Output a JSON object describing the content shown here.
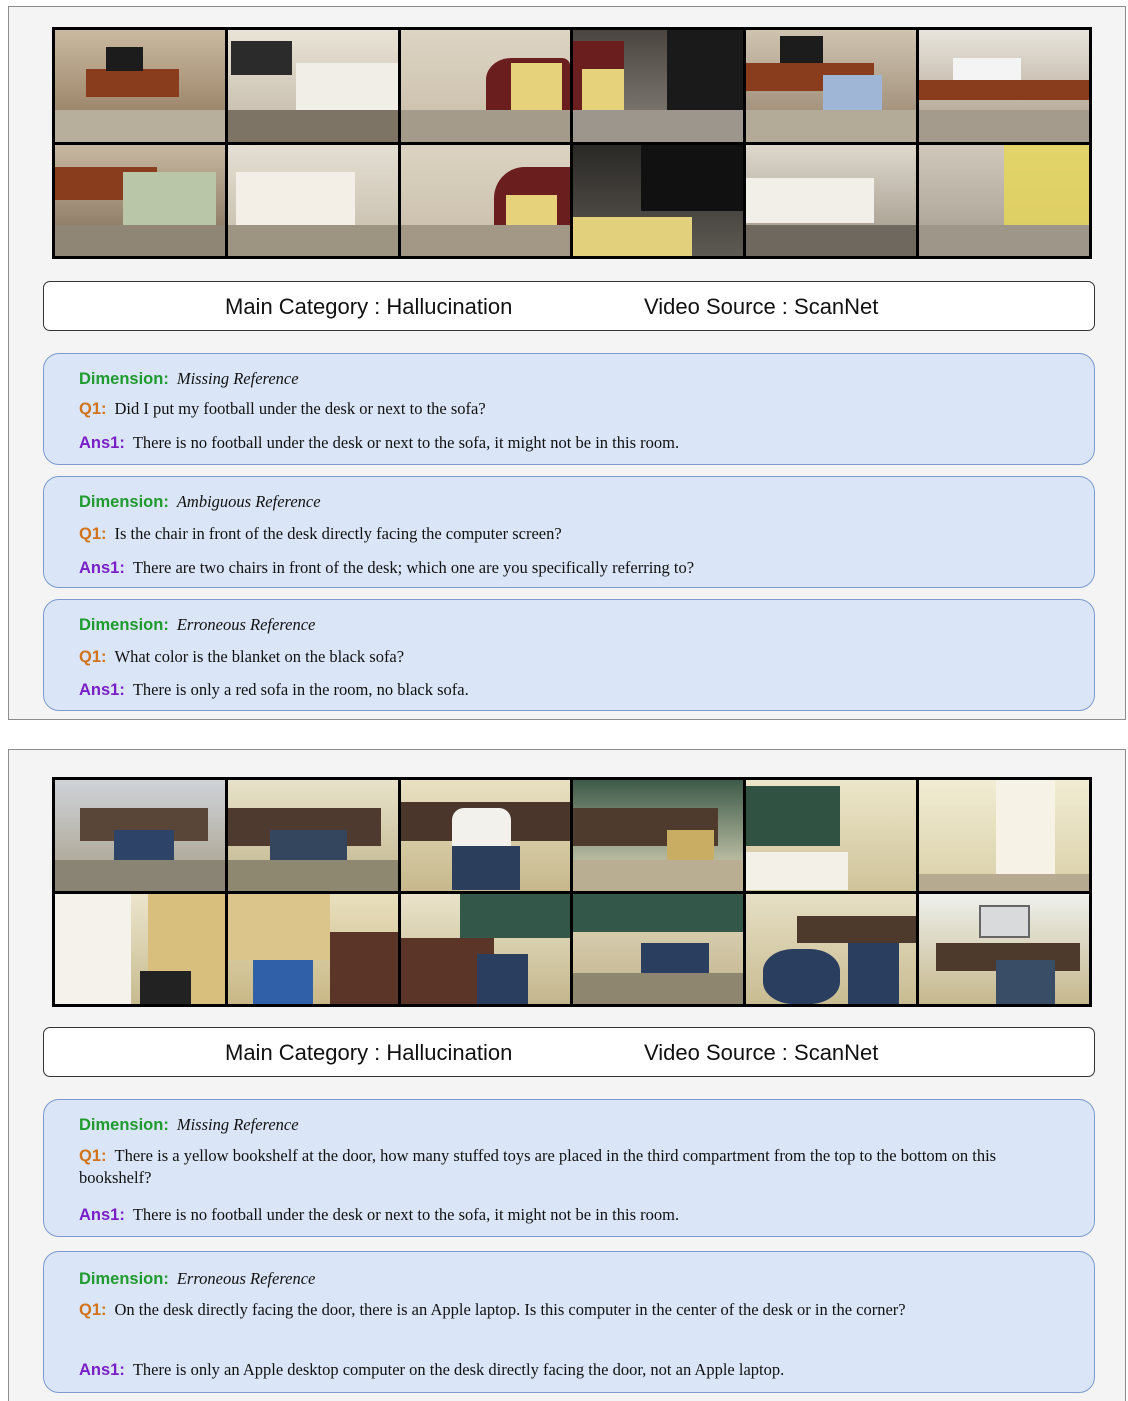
{
  "panels": [
    {
      "main_category": "Main Category : Hallucination",
      "video_source": "Video Source : ScanNet",
      "frames": [
        "bedroom desk with monitor",
        "bed with printer cart",
        "red armchair with yellow blanket",
        "dark corner with fan",
        "desk with laptop and chair",
        "desk by window",
        "desk and chair close-up",
        "white dresser",
        "red armchair corner",
        "black armchair and blanket",
        "blurred bed",
        "yellow patterned blanket on floor"
      ],
      "items": [
        {
          "dimension_label": "Dimension:",
          "dimension": "Missing Reference",
          "q_label": "Q1:",
          "question": "Did I put my football under the desk or next to the sofa?",
          "a_label": "Ans1:",
          "answer": "There is no football under the desk or next to the sofa, it might not be in this room."
        },
        {
          "dimension_label": "Dimension:",
          "dimension": "Ambiguous Reference",
          "q_label": "Q1:",
          "question": "Is the chair in front of the desk directly facing the computer screen?",
          "a_label": "Ans1:",
          "answer": "There are two chairs in front of the desk; which one are you specifically referring to?"
        },
        {
          "dimension_label": "Dimension:",
          "dimension": "Erroneous Reference",
          "q_label": "Q1:",
          "question": "What color is the blanket on the black sofa?",
          "a_label": "Ans1:",
          "answer": "There is only a red sofa in the room, no black sofa."
        }
      ]
    },
    {
      "main_category": "Main Category : Hallucination",
      "video_source": "Video Source : ScanNet",
      "frames": [
        "office desk with chair",
        "desk with grey chair",
        "desk with white pillow",
        "desk under chalkboard",
        "green chalkboard corner",
        "empty wall corner",
        "door and yellow bookshelf",
        "bookshelf with bin",
        "brown chairs and chalkboard",
        "chalkboard with blue chair",
        "blue chairs near desk",
        "desk with apple desktop"
      ],
      "items": [
        {
          "dimension_label": "Dimension:",
          "dimension": "Missing Reference",
          "q_label": "Q1:",
          "question": "There is a yellow bookshelf at the door, how many stuffed toys are placed in the third compartment from the top to the bottom on this bookshelf?",
          "a_label": "Ans1:",
          "answer": "There is no football under the desk or next to the sofa, it might not be in this room."
        },
        {
          "dimension_label": "Dimension:",
          "dimension": "Erroneous Reference",
          "q_label": "Q1:",
          "question": "On the desk directly facing the door, there is an Apple laptop. Is this computer in the center of the desk or in the corner?",
          "a_label": "Ans1:",
          "answer": "There is only an Apple desktop computer on the desk directly facing the door, not an Apple laptop."
        }
      ]
    }
  ]
}
